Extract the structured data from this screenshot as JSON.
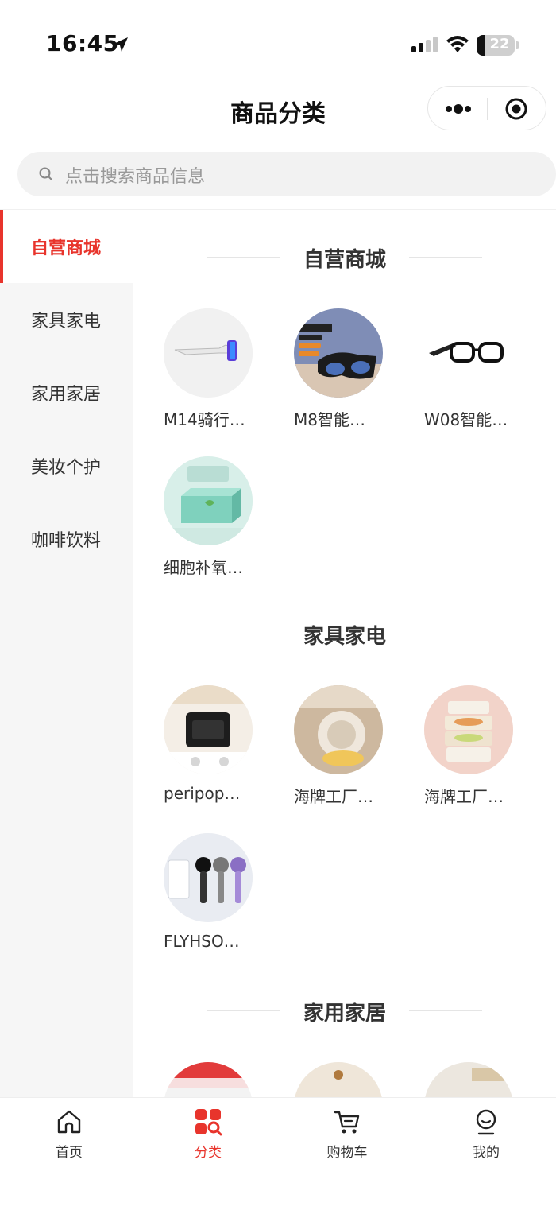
{
  "status_bar": {
    "time": "16:45",
    "battery": "22"
  },
  "nav": {
    "title": "商品分类"
  },
  "search": {
    "placeholder": "点击搜索商品信息"
  },
  "sidebar": {
    "items": [
      {
        "label": "自营商城",
        "active": true
      },
      {
        "label": "家具家电",
        "active": false
      },
      {
        "label": "家用家居",
        "active": false
      },
      {
        "label": "美妆个护",
        "active": false
      },
      {
        "label": "咖啡饮料",
        "active": false
      }
    ]
  },
  "sections": [
    {
      "title": "自营商城",
      "products": [
        {
          "name": "M14骑行…"
        },
        {
          "name": "M8智能…"
        },
        {
          "name": "W08智能…"
        },
        {
          "name": "细胞补氧…"
        }
      ]
    },
    {
      "title": "家具家电",
      "products": [
        {
          "name": "peripop…"
        },
        {
          "name": "海牌工厂…"
        },
        {
          "name": "海牌工厂…"
        },
        {
          "name": "FLYHSO…"
        }
      ]
    },
    {
      "title": "家用家居",
      "products": []
    }
  ],
  "tabbar": {
    "items": [
      {
        "label": "首页",
        "icon": "home-icon"
      },
      {
        "label": "分类",
        "icon": "category-icon",
        "active": true
      },
      {
        "label": "购物车",
        "icon": "cart-icon"
      },
      {
        "label": "我的",
        "icon": "profile-icon"
      }
    ]
  },
  "colors": {
    "accent": "#e8342c",
    "sidebar_bg": "#f6f6f6",
    "search_bg": "#f2f2f2"
  }
}
